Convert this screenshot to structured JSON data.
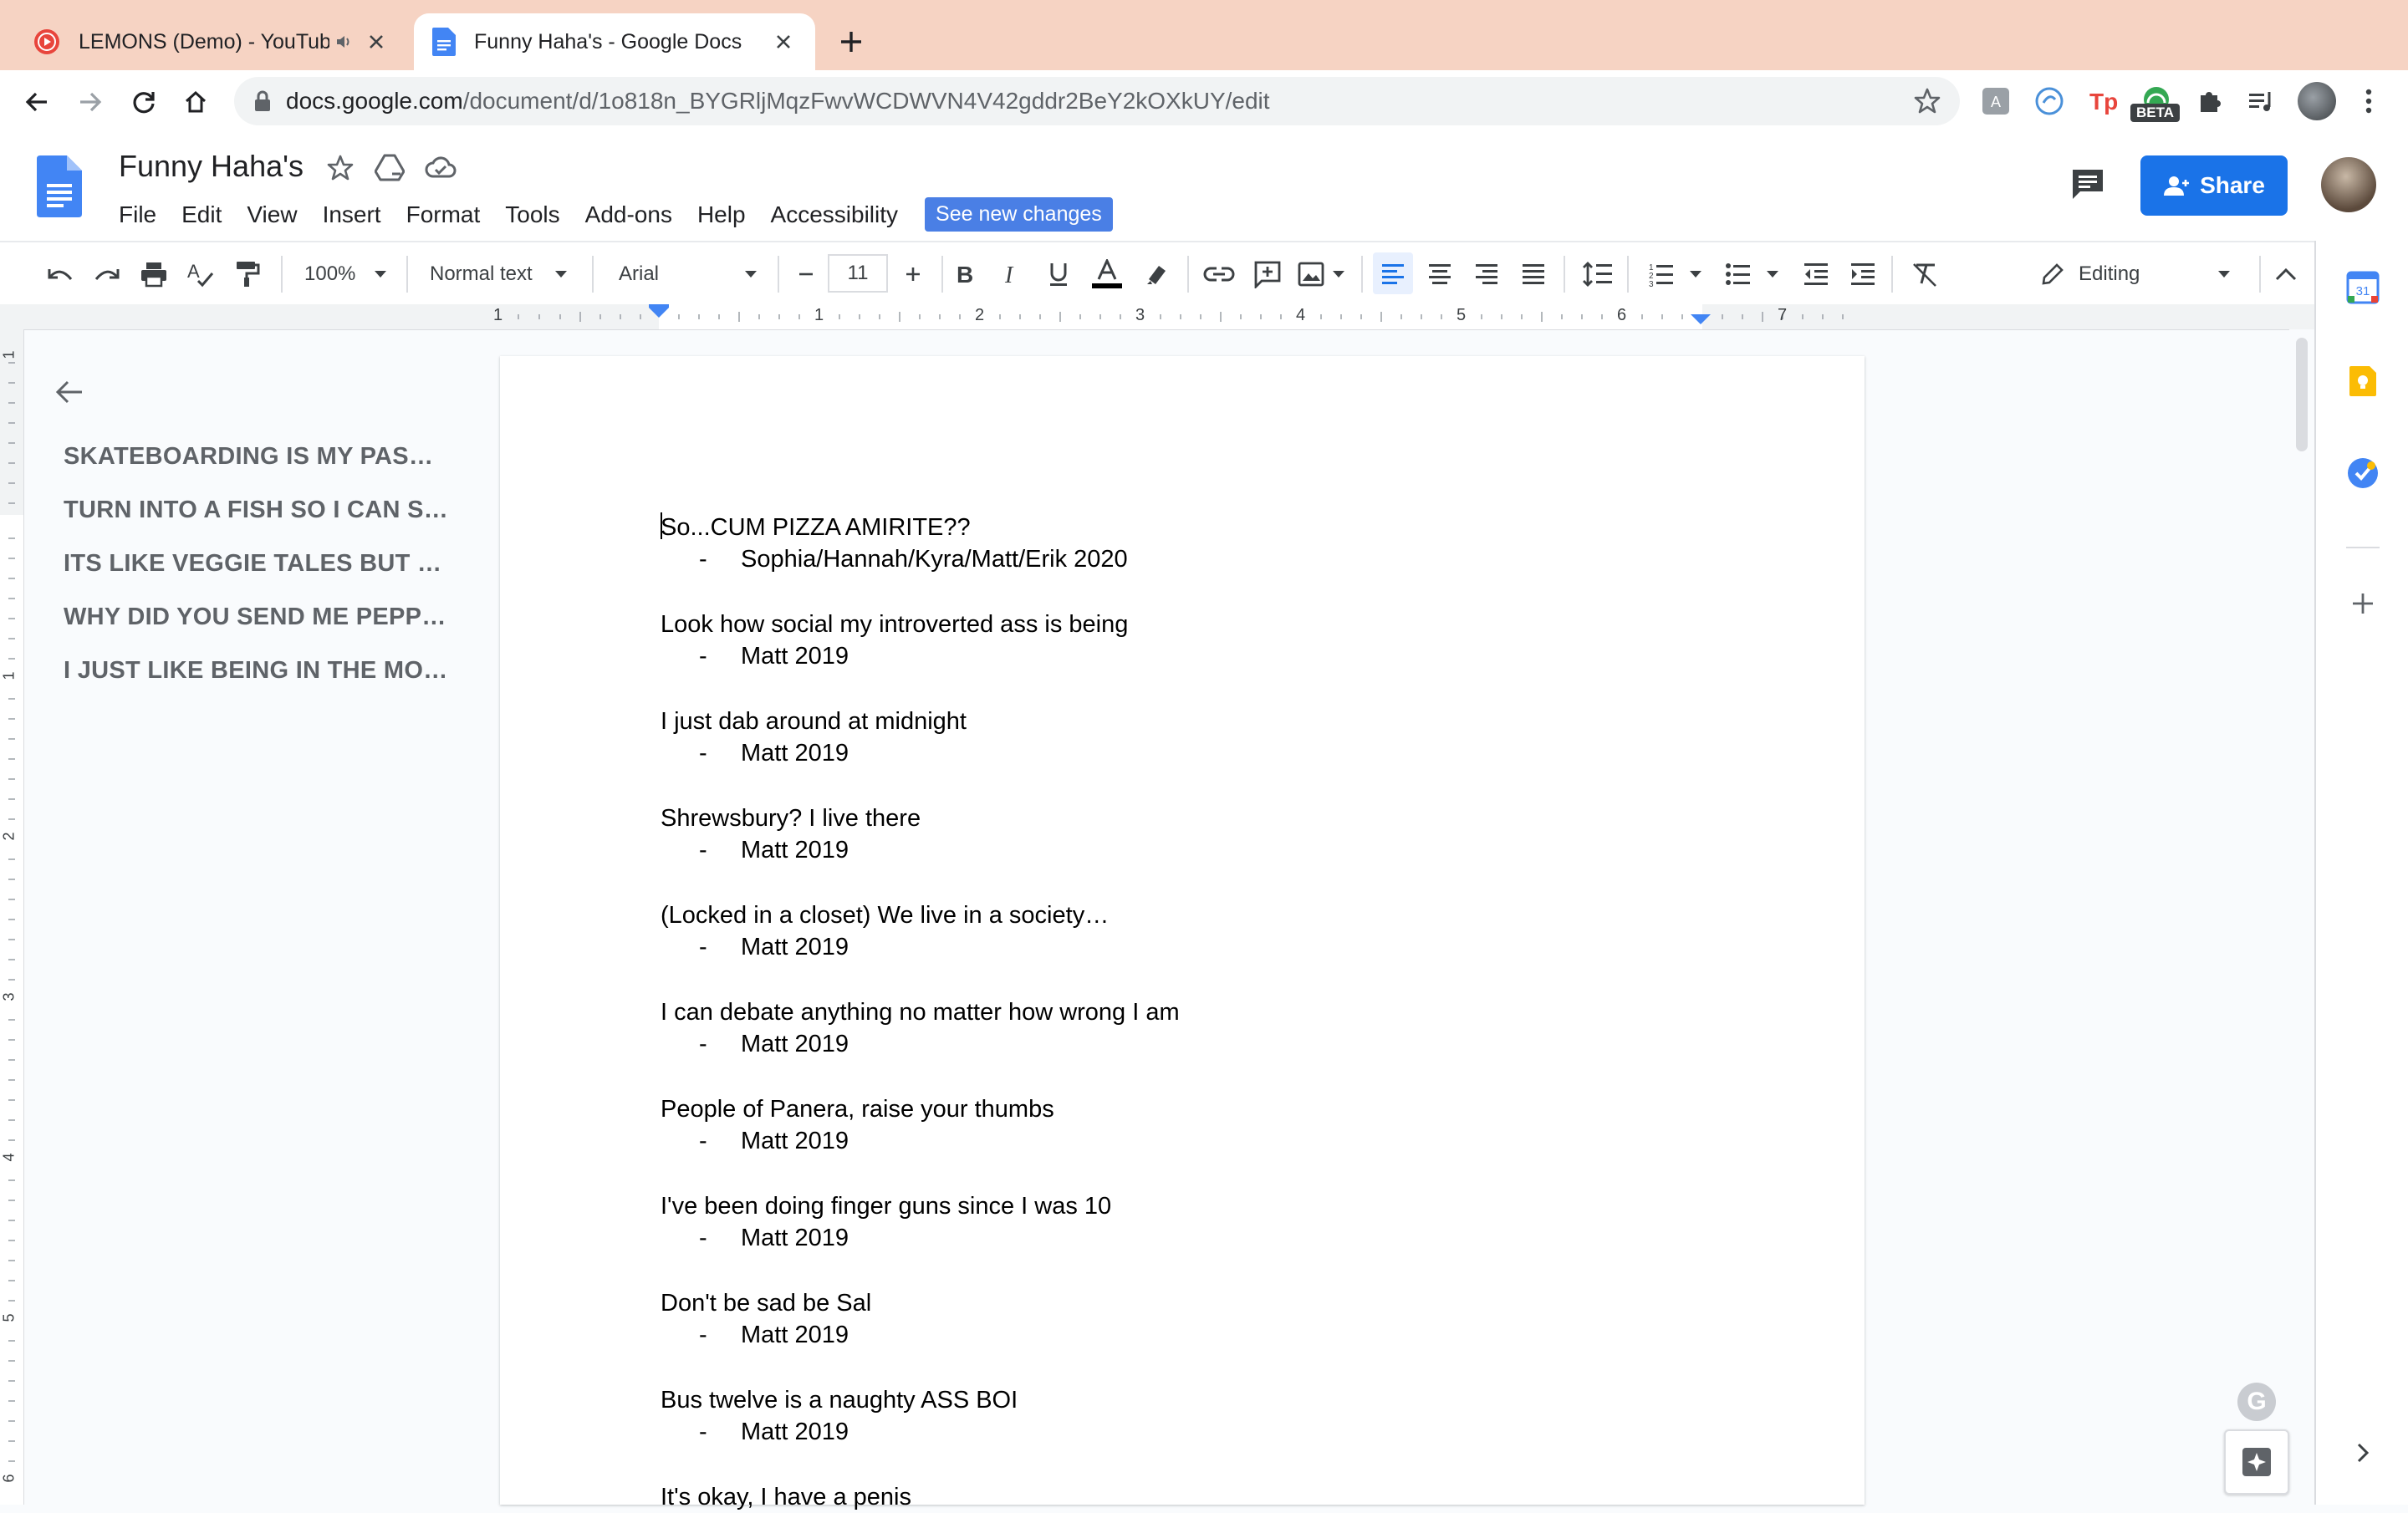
{
  "browser": {
    "tabs": [
      {
        "title": "LEMONS (Demo) - YouTube",
        "icon": "youtube-icon",
        "active": false
      },
      {
        "title": "Funny Haha's - Google Docs",
        "icon": "docs-icon",
        "active": true
      }
    ],
    "url_host": "docs.google.com",
    "url_path": "/document/d/1o818n_BYGRljMqzFwvWCDWVN4V42gddr2BeY2kOXkUY/edit",
    "extension_badge": "BETA"
  },
  "doc": {
    "title": "Funny Haha's",
    "menu": [
      "File",
      "Edit",
      "View",
      "Insert",
      "Format",
      "Tools",
      "Add-ons",
      "Help",
      "Accessibility"
    ],
    "new_changes_label": "See new changes",
    "share_label": "Share"
  },
  "toolbar": {
    "zoom": "100%",
    "style": "Normal text",
    "font": "Arial",
    "font_size": "11",
    "mode": "Editing"
  },
  "ruler": {
    "labels": [
      "1",
      "1",
      "2",
      "3",
      "4",
      "5",
      "6",
      "7"
    ],
    "vlabels": [
      "1",
      "1",
      "2",
      "3",
      "4",
      "5",
      "6"
    ]
  },
  "outline": {
    "items": [
      "SKATEBOARDING IS MY PASSION",
      "TURN INTO A FISH SO I CAN SWIM",
      "ITS LIKE VEGGIE TALES BUT IN REAL LIFE",
      "WHY DID YOU SEND ME PEPPERONI",
      "I JUST LIKE BEING IN THE MOMENT"
    ]
  },
  "entries": [
    {
      "quote": "So...CUM PIZZA AMIRITE??",
      "credit": "Sophia/Hannah/Kyra/Matt/Erik 2020"
    },
    {
      "quote": "Look how social my introverted ass is being",
      "credit": "Matt 2019"
    },
    {
      "quote": "I just dab around at midnight",
      "credit": "Matt 2019"
    },
    {
      "quote": "Shrewsbury? I live there",
      "credit": "Matt 2019"
    },
    {
      "quote": "(Locked in a closet) We live in a society…",
      "credit": "Matt 2019"
    },
    {
      "quote": "I can debate anything no matter how wrong I am",
      "credit": "Matt 2019"
    },
    {
      "quote": "People of Panera, raise your thumbs",
      "credit": "Matt 2019"
    },
    {
      "quote": "I've been doing finger guns since I was 10",
      "credit": "Matt 2019"
    },
    {
      "quote": "Don't be sad be Sal",
      "credit": "Matt 2019"
    },
    {
      "quote": "Bus twelve is a naughty ASS BOI",
      "credit": "Matt 2019"
    },
    {
      "quote": "It's okay, I have a penis",
      "credit": ""
    }
  ],
  "colors": {
    "tabstrip": "#f6d3c3",
    "accent_blue": "#1a73e8",
    "new_changes_bg": "#4a7fe5",
    "outline_text": "#5f6368"
  }
}
